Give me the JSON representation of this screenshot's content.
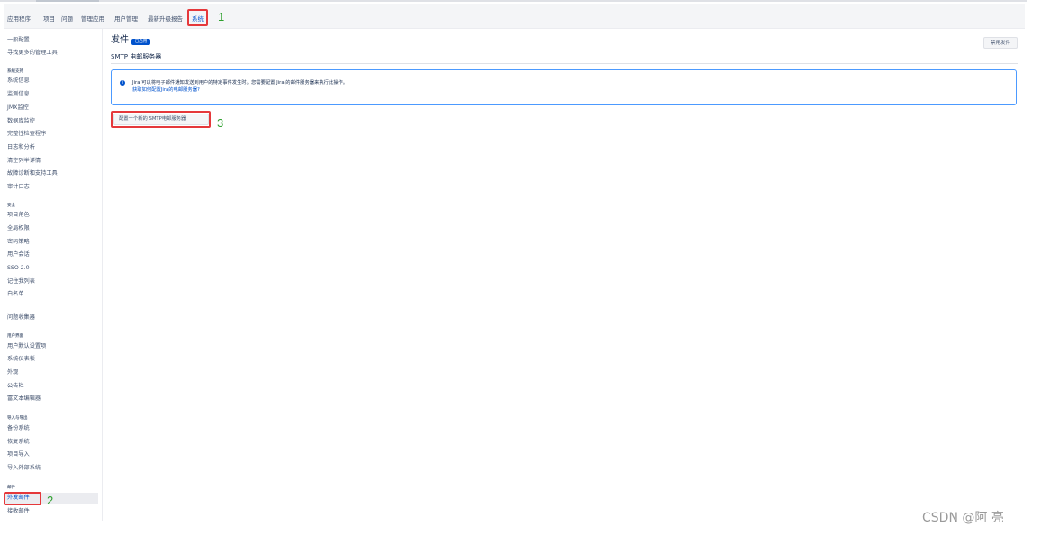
{
  "topnav": {
    "items": [
      "应用程序",
      "项目",
      "问题",
      "管理应用",
      "用户管理",
      "最新升级报告",
      "系统"
    ],
    "active_index": 6
  },
  "sidebar": {
    "items": [
      {
        "type": "item",
        "label": "一般配置"
      },
      {
        "type": "item",
        "label": "寻找更多的管理工具"
      },
      {
        "type": "head",
        "label": "系统支持"
      },
      {
        "type": "item",
        "label": "系统信息"
      },
      {
        "type": "item",
        "label": "监测信息"
      },
      {
        "type": "item",
        "label": "JMX监控"
      },
      {
        "type": "item",
        "label": "数据库监控"
      },
      {
        "type": "item",
        "label": "完整性检查程序"
      },
      {
        "type": "item",
        "label": "日志和分析"
      },
      {
        "type": "item",
        "label": "清空列举详情"
      },
      {
        "type": "item",
        "label": "故障诊断和支持工具"
      },
      {
        "type": "item",
        "label": "审计日志"
      },
      {
        "type": "head",
        "label": "安全"
      },
      {
        "type": "item",
        "label": "项目角色"
      },
      {
        "type": "item",
        "label": "全局权限"
      },
      {
        "type": "item",
        "label": "密码策略"
      },
      {
        "type": "item",
        "label": "用户会话"
      },
      {
        "type": "item",
        "label": "SSO 2.0"
      },
      {
        "type": "item",
        "label": "记住我列表"
      },
      {
        "type": "item",
        "label": "白名单"
      },
      {
        "type": "item",
        "label": "问题收集器"
      },
      {
        "type": "head",
        "label": "用户界面"
      },
      {
        "type": "item",
        "label": "用户默认设置项"
      },
      {
        "type": "item",
        "label": "系统仪表板"
      },
      {
        "type": "item",
        "label": "外观"
      },
      {
        "type": "item",
        "label": "公告栏"
      },
      {
        "type": "item",
        "label": "富文本编辑器"
      },
      {
        "type": "head",
        "label": "导入与导出"
      },
      {
        "type": "item",
        "label": "备份系统"
      },
      {
        "type": "item",
        "label": "恢复系统"
      },
      {
        "type": "item",
        "label": "项目导入"
      },
      {
        "type": "item",
        "label": "导入外部系统"
      },
      {
        "type": "head",
        "label": "邮件"
      },
      {
        "type": "item",
        "label": "外发邮件",
        "selected": true
      },
      {
        "type": "item",
        "label": "接收邮件"
      }
    ]
  },
  "main": {
    "title": "发件",
    "status_badge": "已启用",
    "disable_button": "禁用发件",
    "section_heading": "SMTP 电邮服务器",
    "info_message": "Jira 可以将电子邮件通知发送到用户的特定事件发生时。您需要配置 Jira 的邮件服务器来执行此操作。",
    "info_link": "获取如何配置Jira的电邮服务器?",
    "configure_button": "配置一个新的 SMTP电邮服务器"
  },
  "annotations": [
    "1",
    "2",
    "3"
  ],
  "watermark": "CSDN @阿 亮",
  "colors": {
    "accent": "#0052cc",
    "annotation_box": "#e5383b",
    "annotation_number": "#2ea02e",
    "info_border": "#4c9aff"
  }
}
